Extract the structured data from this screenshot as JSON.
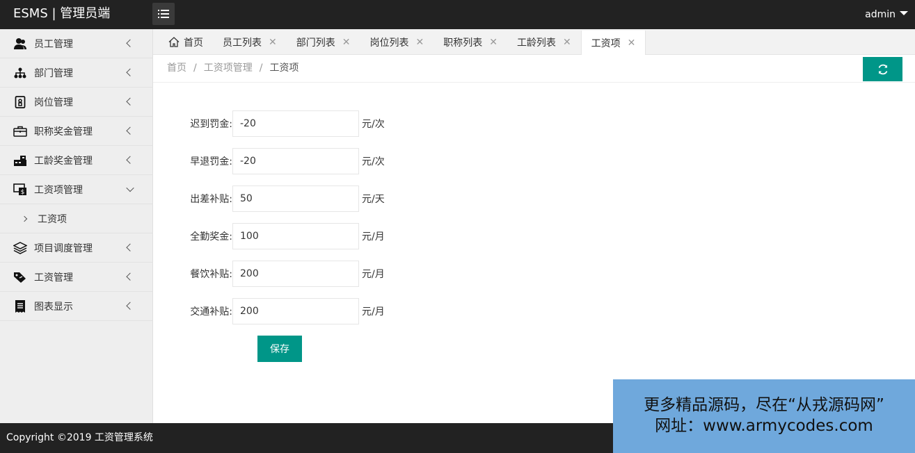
{
  "header": {
    "logo": "ESMS | 管理员端",
    "user": "admin"
  },
  "sidebar": {
    "items": [
      {
        "label": "员工管理",
        "icon": "users-icon"
      },
      {
        "label": "部门管理",
        "icon": "sitemap-icon"
      },
      {
        "label": "岗位管理",
        "icon": "badge-icon"
      },
      {
        "label": "职称奖金管理",
        "icon": "briefcase-icon"
      },
      {
        "label": "工龄奖金管理",
        "icon": "trophy-icon"
      },
      {
        "label": "工资项管理",
        "icon": "money-monitor-icon"
      },
      {
        "label": "项目调度管理",
        "icon": "layers-icon"
      },
      {
        "label": "工资管理",
        "icon": "tag-icon"
      },
      {
        "label": "图表显示",
        "icon": "receipt-icon"
      }
    ],
    "sub_item": "工资项"
  },
  "tabs": [
    {
      "label": "首页"
    },
    {
      "label": "员工列表"
    },
    {
      "label": "部门列表"
    },
    {
      "label": "岗位列表"
    },
    {
      "label": "职称列表"
    },
    {
      "label": "工龄列表"
    },
    {
      "label": "工资项"
    }
  ],
  "tab_close": "✕",
  "breadcrumb": {
    "home": "首页",
    "sep": "/",
    "level2": "工资项管理",
    "current": "工资项"
  },
  "form": {
    "fields": [
      {
        "label": "迟到罚金:",
        "value": "-20",
        "unit": "元/次"
      },
      {
        "label": "早退罚金:",
        "value": "-20",
        "unit": "元/次"
      },
      {
        "label": "出差补贴:",
        "value": "50",
        "unit": "元/天"
      },
      {
        "label": "全勤奖金:",
        "value": "100",
        "unit": "元/月"
      },
      {
        "label": "餐饮补贴:",
        "value": "200",
        "unit": "元/月"
      },
      {
        "label": "交通补贴:",
        "value": "200",
        "unit": "元/月"
      }
    ],
    "save_label": "保存"
  },
  "footer": {
    "copyright": "Copyright ©2019 工资管理系统"
  },
  "watermark": {
    "line1": "更多精品源码，尽在“从戎源码网”",
    "line2": "网址：www.armycodes.com"
  },
  "colors": {
    "accent": "#009688",
    "header": "#222222",
    "watermark": "#6fa8dc"
  }
}
